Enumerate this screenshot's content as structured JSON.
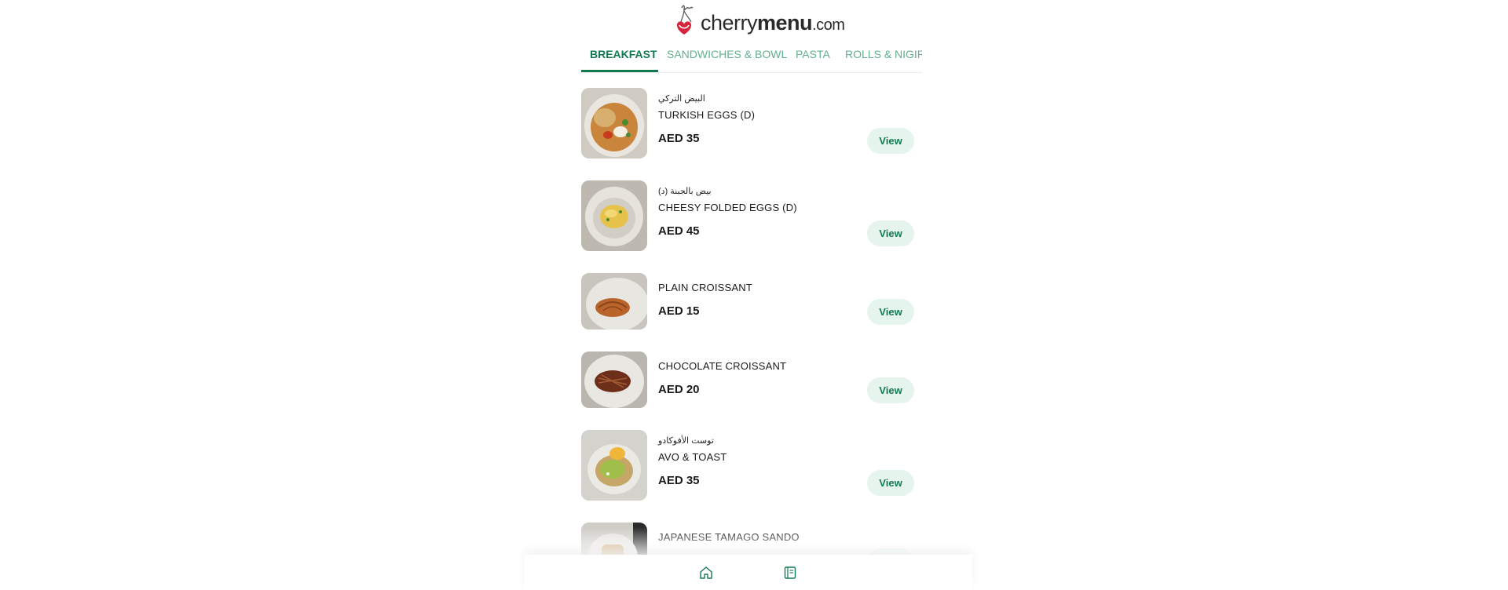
{
  "brand": {
    "name_part1": "cherry",
    "name_part2": "menu",
    "name_part3": ".com",
    "icon": "cherry-logo-icon",
    "accent": "#137a4f",
    "logo_red": "#d6243a"
  },
  "tabs": [
    {
      "label": "BREAKFAST",
      "active": true
    },
    {
      "label": "SANDWICHES & BOWL",
      "active": false
    },
    {
      "label": "PASTA",
      "active": false
    },
    {
      "label": "ROLLS & NIGIRI",
      "active": false
    }
  ],
  "items": [
    {
      "arabic": "البيض التركي",
      "name": "TURKISH EGGS (D)",
      "price": "AED 35",
      "button": "View"
    },
    {
      "arabic": "بيض بالجبنة (د)",
      "name": "CHEESY FOLDED EGGS (D)",
      "price": "AED 45",
      "button": "View"
    },
    {
      "arabic": "",
      "name": "PLAIN CROISSANT",
      "price": "AED 15",
      "button": "View"
    },
    {
      "arabic": "",
      "name": "CHOCOLATE CROISSANT",
      "price": "AED 20",
      "button": "View"
    },
    {
      "arabic": "توست الأفوكادو",
      "name": "AVO & TOAST",
      "price": "AED 35",
      "button": "View"
    },
    {
      "arabic": "",
      "name": "JAPANESE TAMAGO SANDO",
      "price": "",
      "button": "View"
    }
  ],
  "bottom_nav": [
    {
      "icon": "home-icon"
    },
    {
      "icon": "menu-book-icon"
    }
  ]
}
